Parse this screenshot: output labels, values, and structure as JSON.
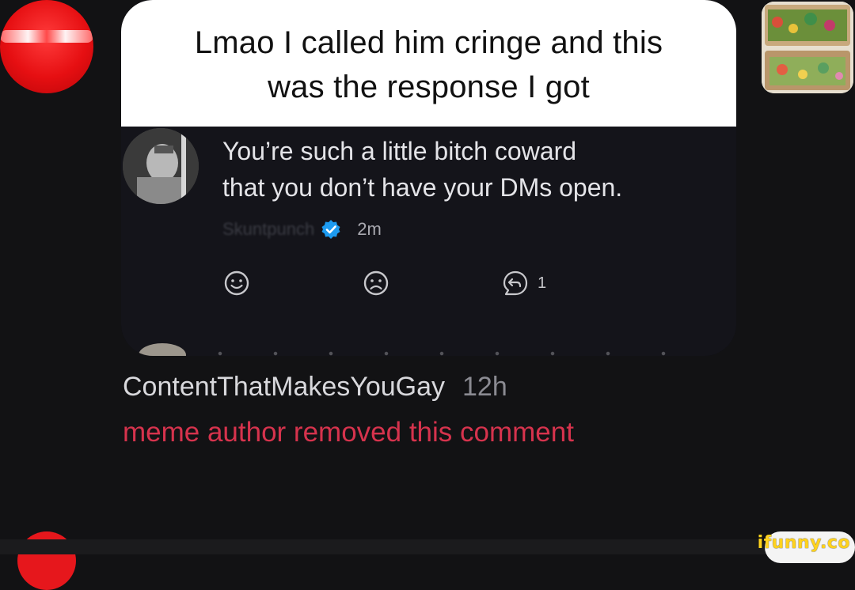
{
  "meme": {
    "caption_line1": "Lmao I called him cringe and this",
    "caption_line2": "was the response I got",
    "tweet": {
      "text_line1": "You’re such a little bitch coward",
      "text_line2": "that you don’t have your DMs open.",
      "username": "Skuntpunch",
      "time": "2m",
      "reply_count": "1"
    }
  },
  "comment": {
    "author": "ContentThatMakesYouGay",
    "time": "12h",
    "status": "meme author removed this comment"
  },
  "watermark": "ifunny.co",
  "colors": {
    "background": "#121214",
    "removed_text": "#d6334d",
    "verified": "#1d9bf0",
    "watermark": "#ffd21e"
  },
  "icons": [
    "smile-icon",
    "frown-icon",
    "reply-icon",
    "verified-badge-icon"
  ]
}
